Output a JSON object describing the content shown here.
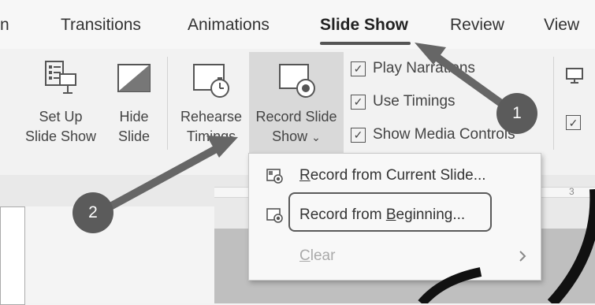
{
  "tabs": [
    {
      "label": "n"
    },
    {
      "label": "Transitions"
    },
    {
      "label": "Animations"
    },
    {
      "label": "Slide Show",
      "active": true
    },
    {
      "label": "Review"
    },
    {
      "label": "View"
    }
  ],
  "ribbon": {
    "setup": {
      "line1": "Set Up",
      "line2": "Slide Show",
      "icon": "setup-slideshow-icon"
    },
    "hide": {
      "line1": "Hide",
      "line2": "Slide",
      "icon": "hide-slide-icon"
    },
    "rehearse": {
      "line1": "Rehearse",
      "line2": "Timings",
      "icon": "rehearse-timings-icon"
    },
    "record": {
      "line1": "Record Slide",
      "line2": "Show",
      "caret": "⌄",
      "icon": "record-slideshow-icon"
    },
    "checkboxes": [
      {
        "label": "Play Narrations",
        "checked": true
      },
      {
        "label": "Use Timings",
        "checked": true
      },
      {
        "label": "Show Media Controls",
        "checked": true
      }
    ],
    "right_checkbox": {
      "checked": true
    }
  },
  "menu": {
    "items": [
      {
        "label": "Record from Current Slide...",
        "mnemonic": "R",
        "rest": "ecord from Current Slide...",
        "icon": "record-current-icon"
      },
      {
        "label_pre": "Record from ",
        "mnemonic": "B",
        "label_post": "eginning...",
        "icon": "record-beginning-icon"
      },
      {
        "mnemonic": "C",
        "rest": "lear",
        "disabled": true,
        "has_submenu": true,
        "icon": "chevron-right-icon"
      }
    ]
  },
  "annotations": {
    "badge1": "1",
    "badge2": "2"
  },
  "ruler": {
    "mark": "3"
  },
  "colors": {
    "annotation": "#5b5b5b",
    "highlight": "#d9d9d9"
  }
}
